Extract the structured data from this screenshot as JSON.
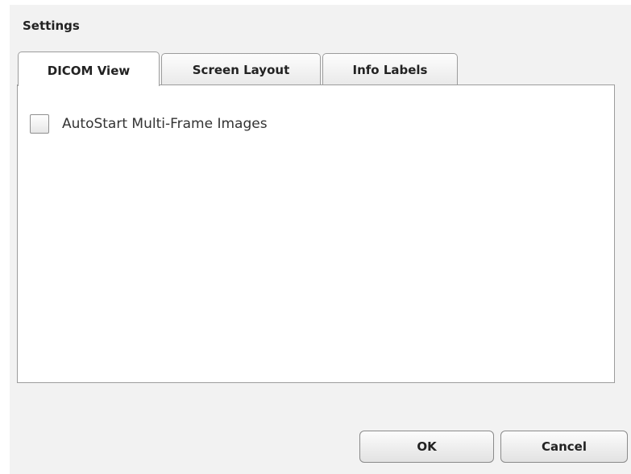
{
  "dialog": {
    "title": "Settings"
  },
  "tabs": [
    {
      "label": "DICOM View",
      "active": true
    },
    {
      "label": "Screen Layout",
      "active": false
    },
    {
      "label": "Info Labels",
      "active": false
    }
  ],
  "dicom_view": {
    "autostart_label": "AutoStart Multi-Frame Images",
    "autostart_checked": false
  },
  "buttons": {
    "ok": "OK",
    "cancel": "Cancel"
  }
}
